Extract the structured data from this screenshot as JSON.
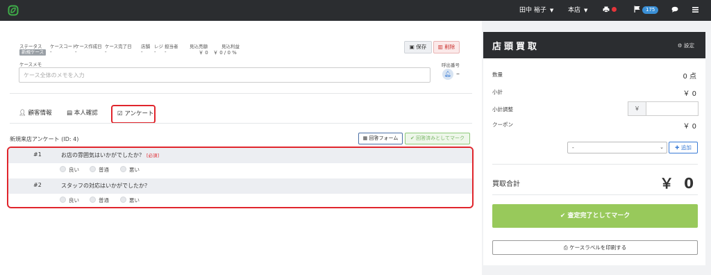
{
  "topbar": {
    "logo": "leaf-logo-icon",
    "user_name": "田中 裕子",
    "store": "本店",
    "notification_count": "175",
    "colors": {
      "bar": "#2b2d30",
      "badge": "#3a8fd6",
      "dot": "#e5353a"
    }
  },
  "case": {
    "headers": [
      "ステータス",
      "ケースコード",
      "ケース作成日",
      "ケース完了日",
      "店舗",
      "レジ",
      "担当者",
      "見込売額",
      "見込利益"
    ],
    "status": "新規ケース",
    "values": [
      "-",
      "-",
      "-",
      "-",
      "-",
      "-"
    ],
    "expected_amount": "￥ 0",
    "expected_profit": "￥ 0 / 0 %",
    "save_label": "保存",
    "delete_label": "削除",
    "memo_label": "ケースメモ",
    "memo_placeholder": "ケース全体のメモを入力",
    "call_label": "呼出番号",
    "call_value": "–"
  },
  "tabs": [
    {
      "label": "顧客情報",
      "icon": "user-icon"
    },
    {
      "label": "本人確認",
      "icon": "id-card-icon"
    },
    {
      "label": "アンケート",
      "icon": "checkbox-icon",
      "active": true
    }
  ],
  "survey": {
    "title": "新規来店アンケート (ID: 4)",
    "form_button": "回答フォーム",
    "done_button": "回答済みとしてマーク",
    "questions": [
      {
        "num": "#1",
        "text": "お店の雰囲気はいかがでしたか？",
        "required": "[必須]",
        "options": [
          "良い",
          "普通",
          "悪い"
        ]
      },
      {
        "num": "#2",
        "text": "スタッフの対応はいかがでしたか？",
        "required": "",
        "options": [
          "良い",
          "普通",
          "悪い"
        ]
      }
    ]
  },
  "side": {
    "title": "店頭買取",
    "settings": "設定",
    "qty_label": "数量",
    "qty_value": "0 点",
    "subtotal_label": "小計",
    "subtotal_value": "￥ 0",
    "adjust_label": "小計調整",
    "adjust_prefix": "￥",
    "coupon_label": "クーポン",
    "coupon_value": "￥ 0",
    "coupon_select": "-",
    "add_label": "追加",
    "total_label": "買取合計",
    "total_value": "￥ 0",
    "complete_label": "査定完了としてマーク",
    "print_label": "ケースラベルを印刷する",
    "colors": {
      "complete": "#98c95b",
      "header": "#2b2d30",
      "highlight": "#e0252c"
    }
  }
}
